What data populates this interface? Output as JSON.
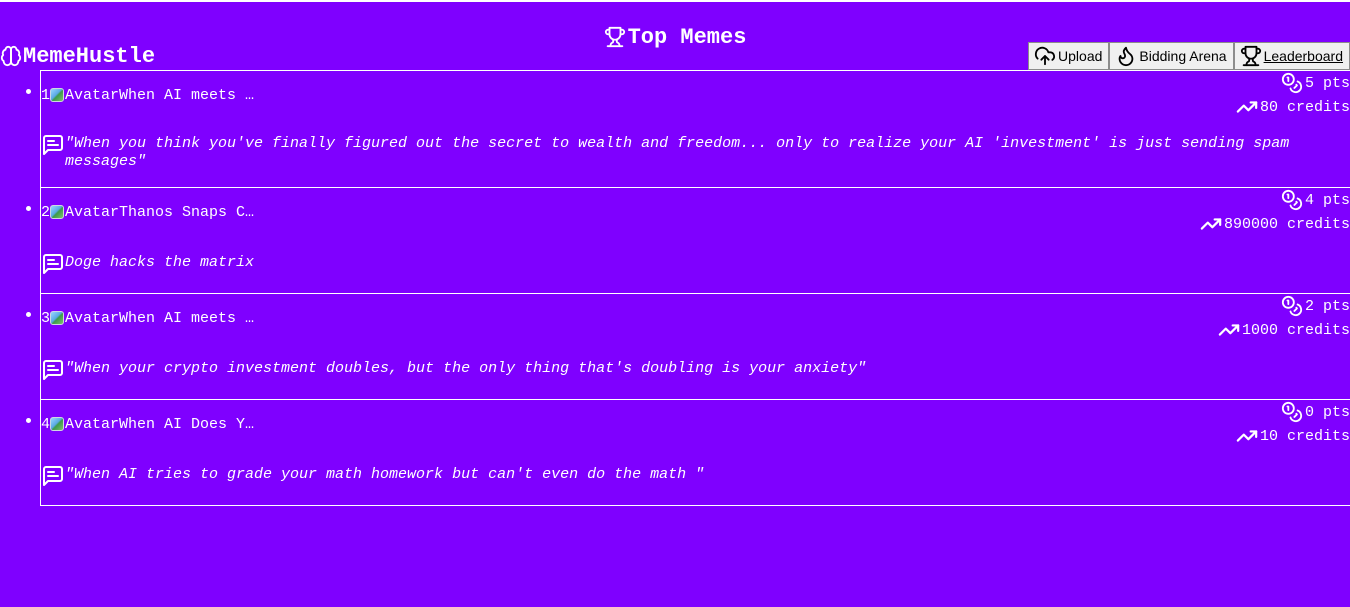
{
  "app": {
    "brand": "MemeHustle"
  },
  "page": {
    "title": "Top Memes"
  },
  "nav": {
    "upload": "Upload",
    "bidding": "Bidding Arena",
    "leaderboard": "Leaderboard"
  },
  "memes": [
    {
      "rank": "1",
      "avatar_alt": "Avatar",
      "title": "When AI meets …",
      "points": "5 pts",
      "credits": "80 credits",
      "caption": "\"When you think you've finally figured out the secret to wealth and freedom... only to realize your AI 'investment' is just sending spam messages\""
    },
    {
      "rank": "2",
      "avatar_alt": "Avatar",
      "title": "Thanos Snaps C…",
      "points": "4 pts",
      "credits": "890000 credits",
      "caption": "Doge hacks the matrix"
    },
    {
      "rank": "3",
      "avatar_alt": "Avatar",
      "title": "When AI meets …",
      "points": "2 pts",
      "credits": "1000 credits",
      "caption": "\"When your crypto investment doubles, but the only thing that's doubling is your anxiety\""
    },
    {
      "rank": "4",
      "avatar_alt": "Avatar",
      "title": "When AI Does Y…",
      "points": "0 pts",
      "credits": "10 credits",
      "caption": "\"When AI tries to grade your math homework but can't even do the math \""
    }
  ],
  "colors": {
    "background": "#7f00ff",
    "text": "#ffffff",
    "button_bg": "#f0f0f0"
  },
  "icons": {
    "brand": "brain-icon",
    "title": "trophy-icon",
    "upload": "cloud-upload-icon",
    "bidding": "flame-icon",
    "leaderboard": "trophy-icon",
    "points": "coins-icon",
    "credits": "trending-up-icon",
    "caption": "message-square-text-icon"
  }
}
